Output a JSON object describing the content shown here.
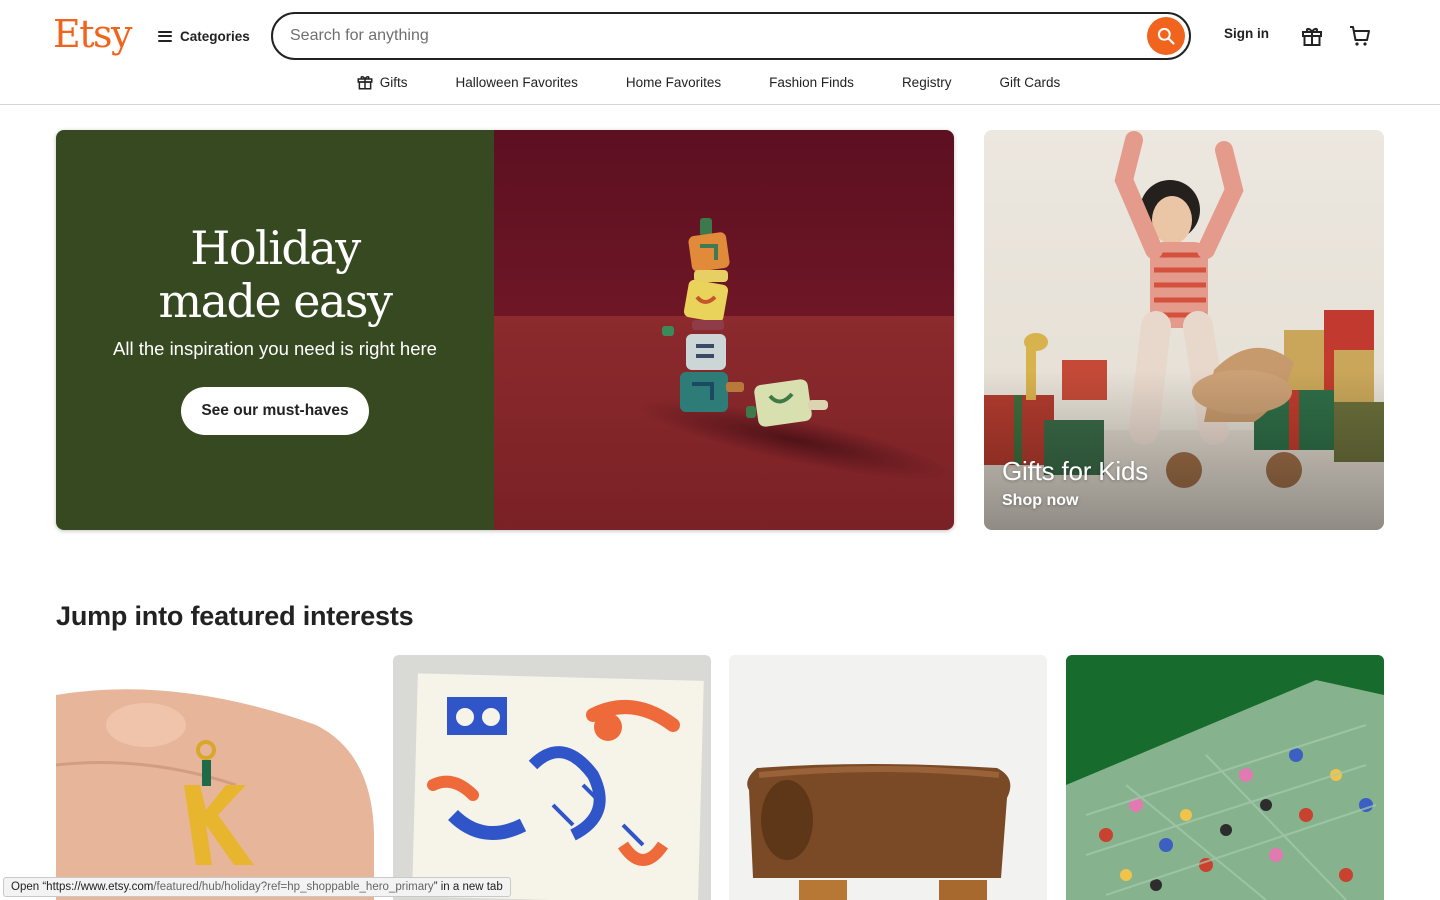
{
  "header": {
    "logo": "Etsy",
    "categories_label": "Categories",
    "search_placeholder": "Search for anything",
    "signin_label": "Sign in",
    "icons": {
      "search": "search-icon",
      "gift": "gift-icon",
      "cart": "cart-icon",
      "menu": "menu-icon"
    }
  },
  "subnav": {
    "items": [
      {
        "label": "Gifts",
        "icon": "gift-icon"
      },
      {
        "label": "Halloween Favorites"
      },
      {
        "label": "Home Favorites"
      },
      {
        "label": "Fashion Finds"
      },
      {
        "label": "Registry"
      },
      {
        "label": "Gift Cards"
      }
    ]
  },
  "hero": {
    "title_line1": "Holiday",
    "title_line2": "made easy",
    "subtitle": "All the inspiration you need is right here",
    "cta": "See our must-haves"
  },
  "side_promo": {
    "title": "Gifts for Kids",
    "link": "Shop now"
  },
  "featured": {
    "title": "Jump into featured interests"
  },
  "status_bar": {
    "prefix": "Open “",
    "url_host": "https://www.etsy.com",
    "url_path": "/featured/hub/holiday?ref=hp_shoppable_hero_primary",
    "suffix": "” in a new tab"
  },
  "colors": {
    "brand": "#f1641e",
    "hero_green": "#374921",
    "hero_red": "#8a2a2e"
  }
}
